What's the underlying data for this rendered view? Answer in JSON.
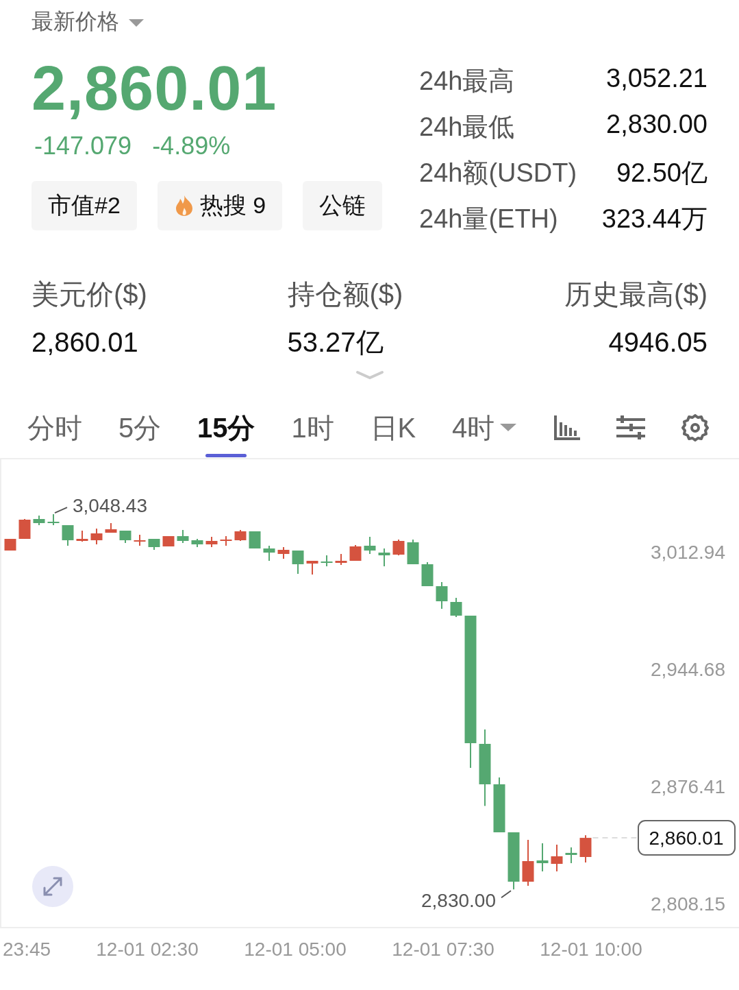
{
  "header": {
    "title": "最新价格"
  },
  "price": {
    "last": "2,860.01",
    "change": "-147.079",
    "change_pct": "-4.89%"
  },
  "tags": [
    {
      "label": "市值#2",
      "kind": "plain"
    },
    {
      "label": "热搜 9",
      "kind": "hot"
    },
    {
      "label": "公链",
      "kind": "plain"
    }
  ],
  "stats": [
    {
      "label": "24h最高",
      "value": "3,052.21"
    },
    {
      "label": "24h最低",
      "value": "2,830.00"
    },
    {
      "label": "24h额(USDT)",
      "value": "92.50亿"
    },
    {
      "label": "24h量(ETH)",
      "value": "323.44万"
    }
  ],
  "info": [
    {
      "label": "美元价($)",
      "value": "2,860.01"
    },
    {
      "label": "持仓额($)",
      "value": "53.27亿"
    },
    {
      "label": "历史最高($)",
      "value": "4946.05"
    }
  ],
  "tabs": [
    {
      "label": "分时",
      "selected": false,
      "dropdown": false
    },
    {
      "label": "5分",
      "selected": false,
      "dropdown": false
    },
    {
      "label": "15分",
      "selected": true,
      "dropdown": false
    },
    {
      "label": "1时",
      "selected": false,
      "dropdown": false
    },
    {
      "label": "日K",
      "selected": false,
      "dropdown": false
    },
    {
      "label": "4时",
      "selected": false,
      "dropdown": true
    }
  ],
  "chart": {
    "kind": "candlestick",
    "high_marker": "3,048.43",
    "low_marker": "2,830.00",
    "last_price_tag": "2,860.01",
    "y_axis_labels": [
      "3,012.94",
      "2,944.68",
      "2,876.41",
      "2,808.15"
    ],
    "x_axis_labels": [
      "23:45",
      "12-01 02:30",
      "12-01 05:00",
      "12-01 07:30",
      "12-01 10:00"
    ]
  }
}
